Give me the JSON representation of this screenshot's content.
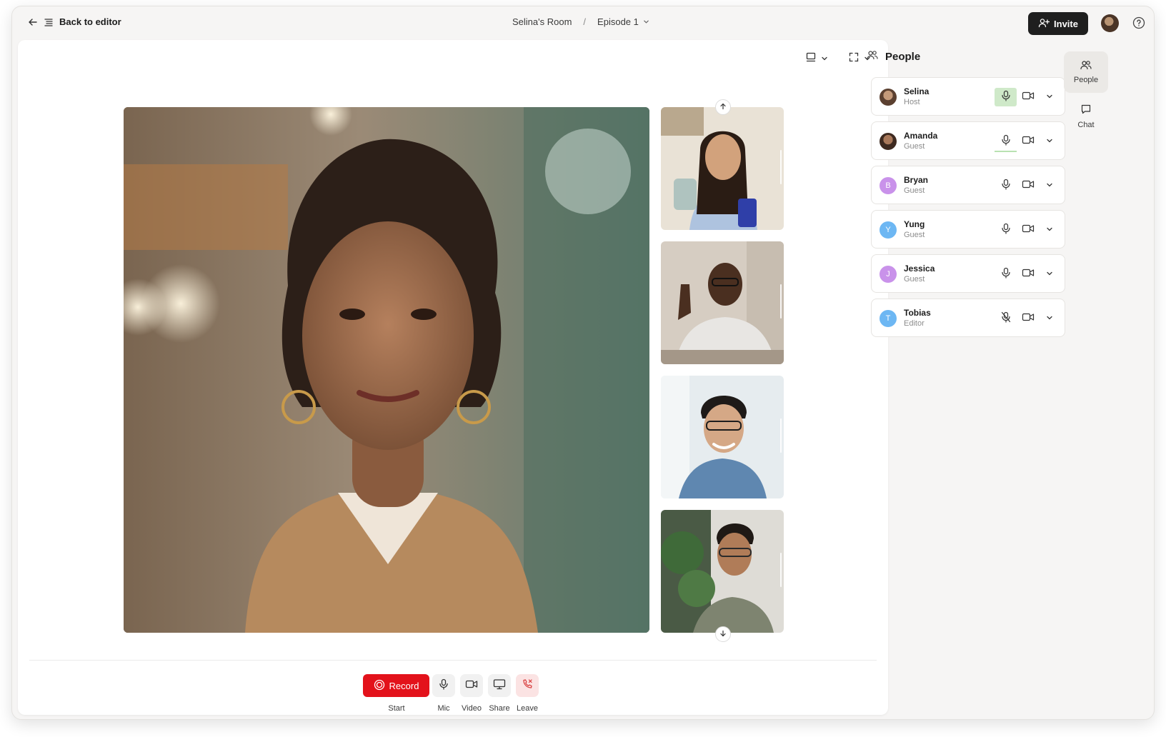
{
  "topbar": {
    "back_label": "Back to editor",
    "room_name": "Selina's Room",
    "separator": "/",
    "episode_label": "Episode 1",
    "invite_label": "Invite"
  },
  "people": {
    "header": "People",
    "list": [
      {
        "name": "Selina",
        "role": "Host",
        "initial": "",
        "avatar_color": "#8a6e55",
        "mic": "speaking"
      },
      {
        "name": "Amanda",
        "role": "Guest",
        "initial": "",
        "avatar_color": "#6a4a38",
        "mic": "on"
      },
      {
        "name": "Bryan",
        "role": "Guest",
        "initial": "B",
        "avatar_color": "#c992ea",
        "mic": "on"
      },
      {
        "name": "Yung",
        "role": "Guest",
        "initial": "Y",
        "avatar_color": "#6db7f3",
        "mic": "on"
      },
      {
        "name": "Jessica",
        "role": "Guest",
        "initial": "J",
        "avatar_color": "#c992ea",
        "mic": "on"
      },
      {
        "name": "Tobias",
        "role": "Editor",
        "initial": "T",
        "avatar_color": "#6db7f3",
        "mic": "muted"
      }
    ]
  },
  "rail": {
    "people_label": "People",
    "chat_label": "Chat"
  },
  "controls": {
    "record_label": "Record",
    "start_label": "Start",
    "mic_label": "Mic",
    "video_label": "Video",
    "share_label": "Share",
    "leave_label": "Leave"
  },
  "colors": {
    "record": "#e3121b",
    "invite_bg": "#1f1f1f",
    "speaking": "#cfe9c9",
    "leave_bg": "#fbe3e3"
  }
}
